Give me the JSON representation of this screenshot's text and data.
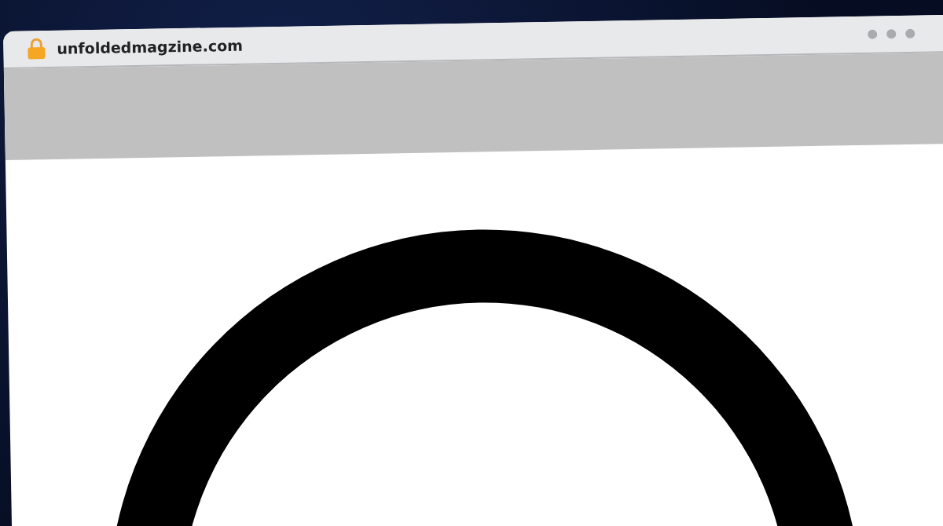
{
  "browser": {
    "url": "unfoldedmagzine.com"
  }
}
